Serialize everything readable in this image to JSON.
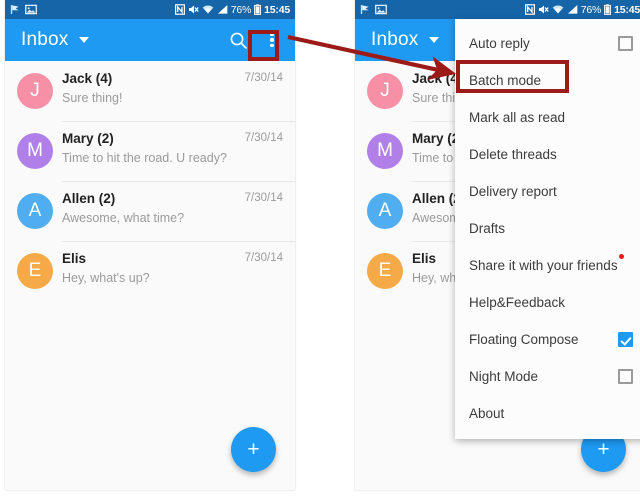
{
  "status_bar": {
    "left_icons": [
      "flag-icon",
      "image-icon"
    ],
    "right_icons": [
      "nfc-icon",
      "mute-icon",
      "wifi-icon",
      "signal-icon",
      "battery-icon"
    ],
    "battery_percent": "76%",
    "time": "15:45"
  },
  "toolbar": {
    "title": "Inbox",
    "caret_icon": "chevron-down-icon",
    "search_icon": "search-icon",
    "overflow_icon": "overflow-menu-icon"
  },
  "mail_list": {
    "rows": [
      {
        "initial": "J",
        "color": "#f78fa7",
        "sender": "Jack (4)",
        "snippet": "Sure thing!",
        "date": "7/30/14"
      },
      {
        "initial": "M",
        "color": "#b07fe8",
        "sender": "Mary (2)",
        "snippet": "Time to hit the road. U ready?",
        "date": "7/30/14"
      },
      {
        "initial": "A",
        "color": "#4fadf0",
        "sender": "Allen (2)",
        "snippet": "Awesome, what time?",
        "date": "7/30/14"
      },
      {
        "initial": "E",
        "color": "#f5a947",
        "sender": "Elis",
        "snippet": "Hey, what's up?",
        "date": "7/30/14"
      }
    ]
  },
  "fab": {
    "label": "+",
    "icon": "plus-icon",
    "color": "#1e9af3"
  },
  "overflow_menu": {
    "items": [
      {
        "label": "Auto reply",
        "control": "checkbox",
        "checked": false,
        "badge": false
      },
      {
        "label": "Batch mode",
        "control": "none",
        "checked": false,
        "badge": false
      },
      {
        "label": "Mark all as read",
        "control": "none",
        "checked": false,
        "badge": false
      },
      {
        "label": "Delete threads",
        "control": "none",
        "checked": false,
        "badge": false
      },
      {
        "label": "Delivery report",
        "control": "none",
        "checked": false,
        "badge": false
      },
      {
        "label": "Drafts",
        "control": "none",
        "checked": false,
        "badge": false
      },
      {
        "label": "Share it with your friends",
        "control": "none",
        "checked": false,
        "badge": true
      },
      {
        "label": "Help&Feedback",
        "control": "none",
        "checked": false,
        "badge": false
      },
      {
        "label": "Floating Compose",
        "control": "checkbox",
        "checked": true,
        "badge": false
      },
      {
        "label": "Night Mode",
        "control": "checkbox",
        "checked": false,
        "badge": false
      },
      {
        "label": "About",
        "control": "none",
        "checked": false,
        "badge": false
      }
    ]
  },
  "annotations": {
    "highlight_color": "#9c1b18",
    "arrow_from": "overflow-menu-icon",
    "arrow_to": "menu-item-batch-mode"
  },
  "colors": {
    "toolbar_blue": "#1e9af3",
    "statusbar_blue": "#1565a8",
    "accent_red": "#9c1b18",
    "badge_red": "#f01a1a"
  }
}
